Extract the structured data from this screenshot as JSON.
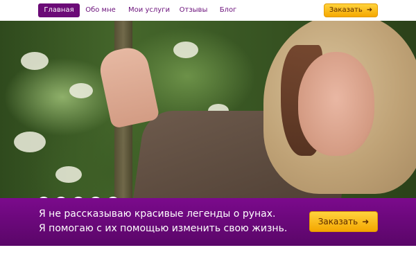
{
  "nav": {
    "items": [
      {
        "label": "Главная",
        "active": true
      },
      {
        "label": "Обо мне",
        "active": false
      },
      {
        "label": "Мои услуги",
        "active": false
      },
      {
        "label": "Отзывы",
        "active": false
      },
      {
        "label": "Блог",
        "active": false
      }
    ],
    "order_button": {
      "label": "Заказать",
      "icon": "arrow-right-icon"
    }
  },
  "hero": {
    "slides_count": 5,
    "active_slide": 1
  },
  "banner": {
    "line1": "Я не рассказываю красивые легенды о рунах.",
    "line2": "Я помогаю с их помощью изменить свою жизнь.",
    "order_button": {
      "label": "Заказать",
      "icon": "arrow-right-icon"
    }
  },
  "colors": {
    "brand_purple": "#6b0b77",
    "accent_orange": "#f5a800"
  }
}
